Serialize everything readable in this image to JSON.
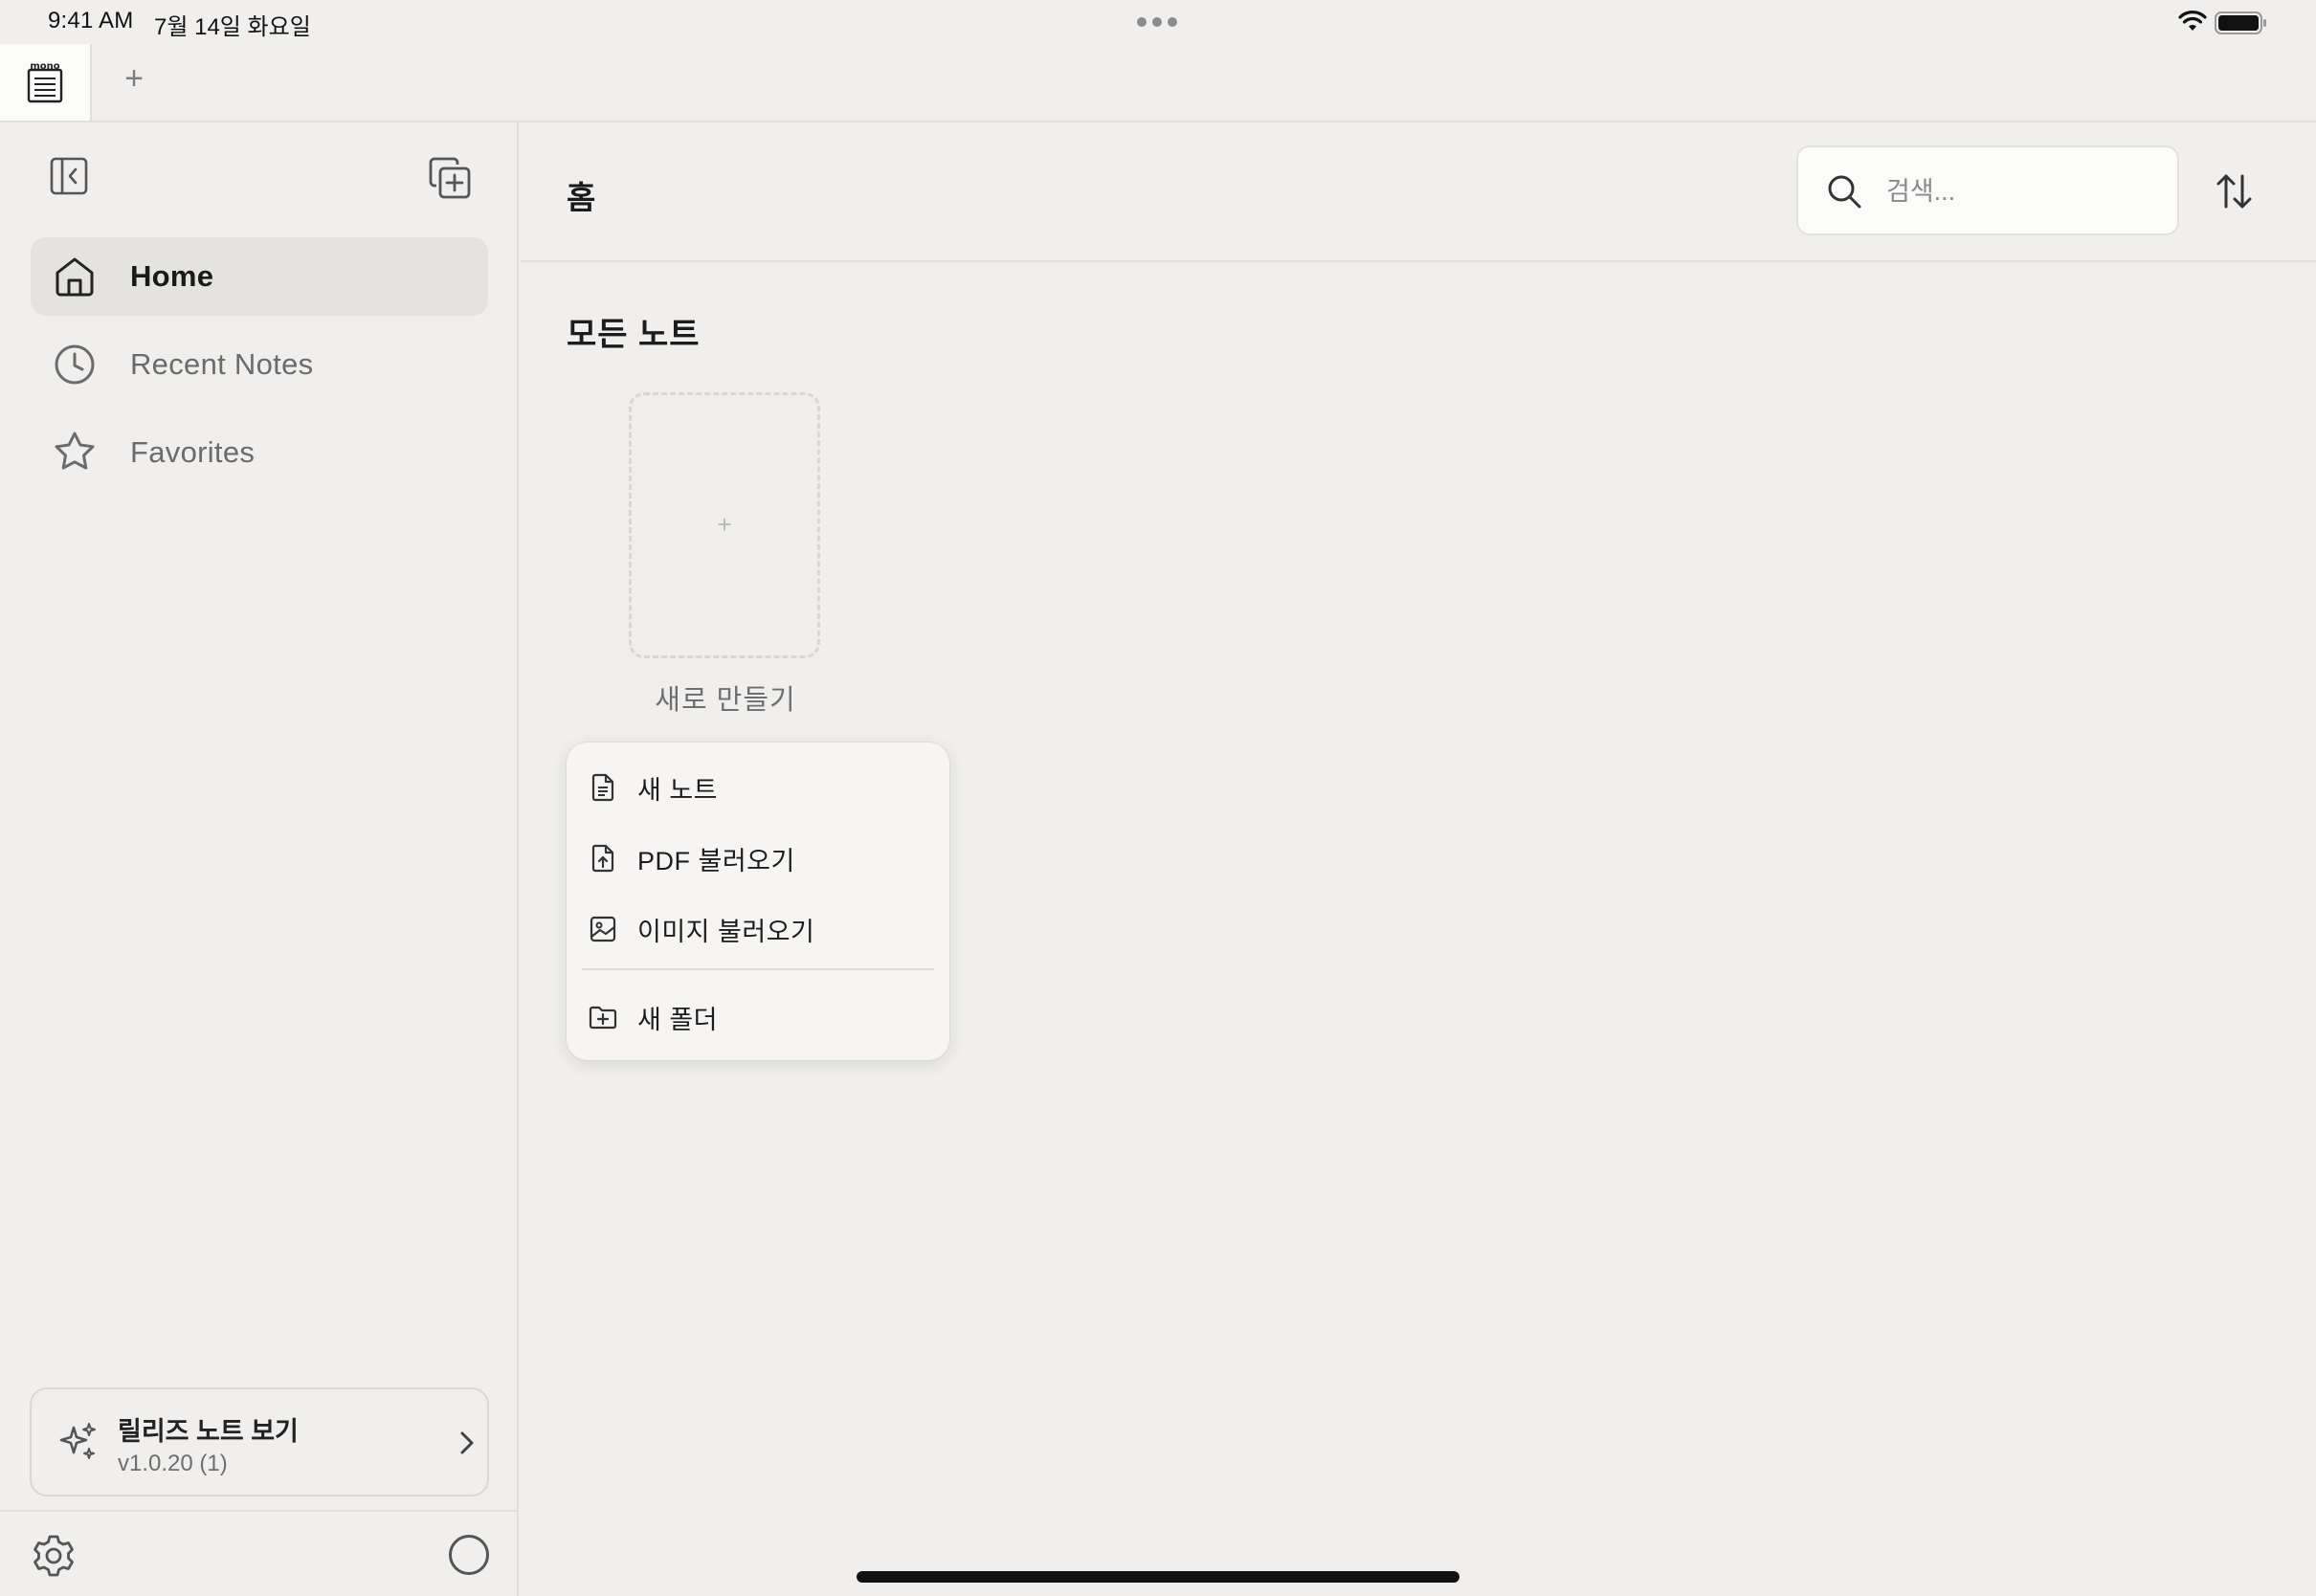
{
  "status_bar": {
    "time": "9:41 AM",
    "date": "7월 14일 화요일"
  },
  "tabs": {
    "app_tab_icon": "mono-notebook-icon",
    "add_tab_label": "+"
  },
  "sidebar": {
    "items": [
      {
        "label": "Home",
        "icon": "home-icon",
        "active": true
      },
      {
        "label": "Recent Notes",
        "icon": "clock-icon",
        "active": false
      },
      {
        "label": "Favorites",
        "icon": "star-icon",
        "active": false
      }
    ],
    "release_card": {
      "title": "릴리즈 노트 보기",
      "version": "v1.0.20 (1)"
    }
  },
  "main": {
    "title": "홈",
    "search": {
      "placeholder": "검색...",
      "value": ""
    },
    "section_title": "모든 노트",
    "new_card": {
      "plus": "+",
      "label": "새로 만들기"
    }
  },
  "menu": {
    "items": [
      {
        "label": "새 노트",
        "icon": "document-icon"
      },
      {
        "label": "PDF 불러오기",
        "icon": "pdf-import-icon"
      },
      {
        "label": "이미지 불러오기",
        "icon": "image-icon"
      },
      {
        "label": "새 폴더",
        "icon": "folder-plus-icon"
      }
    ]
  },
  "colors": {
    "background": "#f0efed",
    "active_nav": "#e5e3df",
    "menu_background": "#f6f5f3"
  }
}
